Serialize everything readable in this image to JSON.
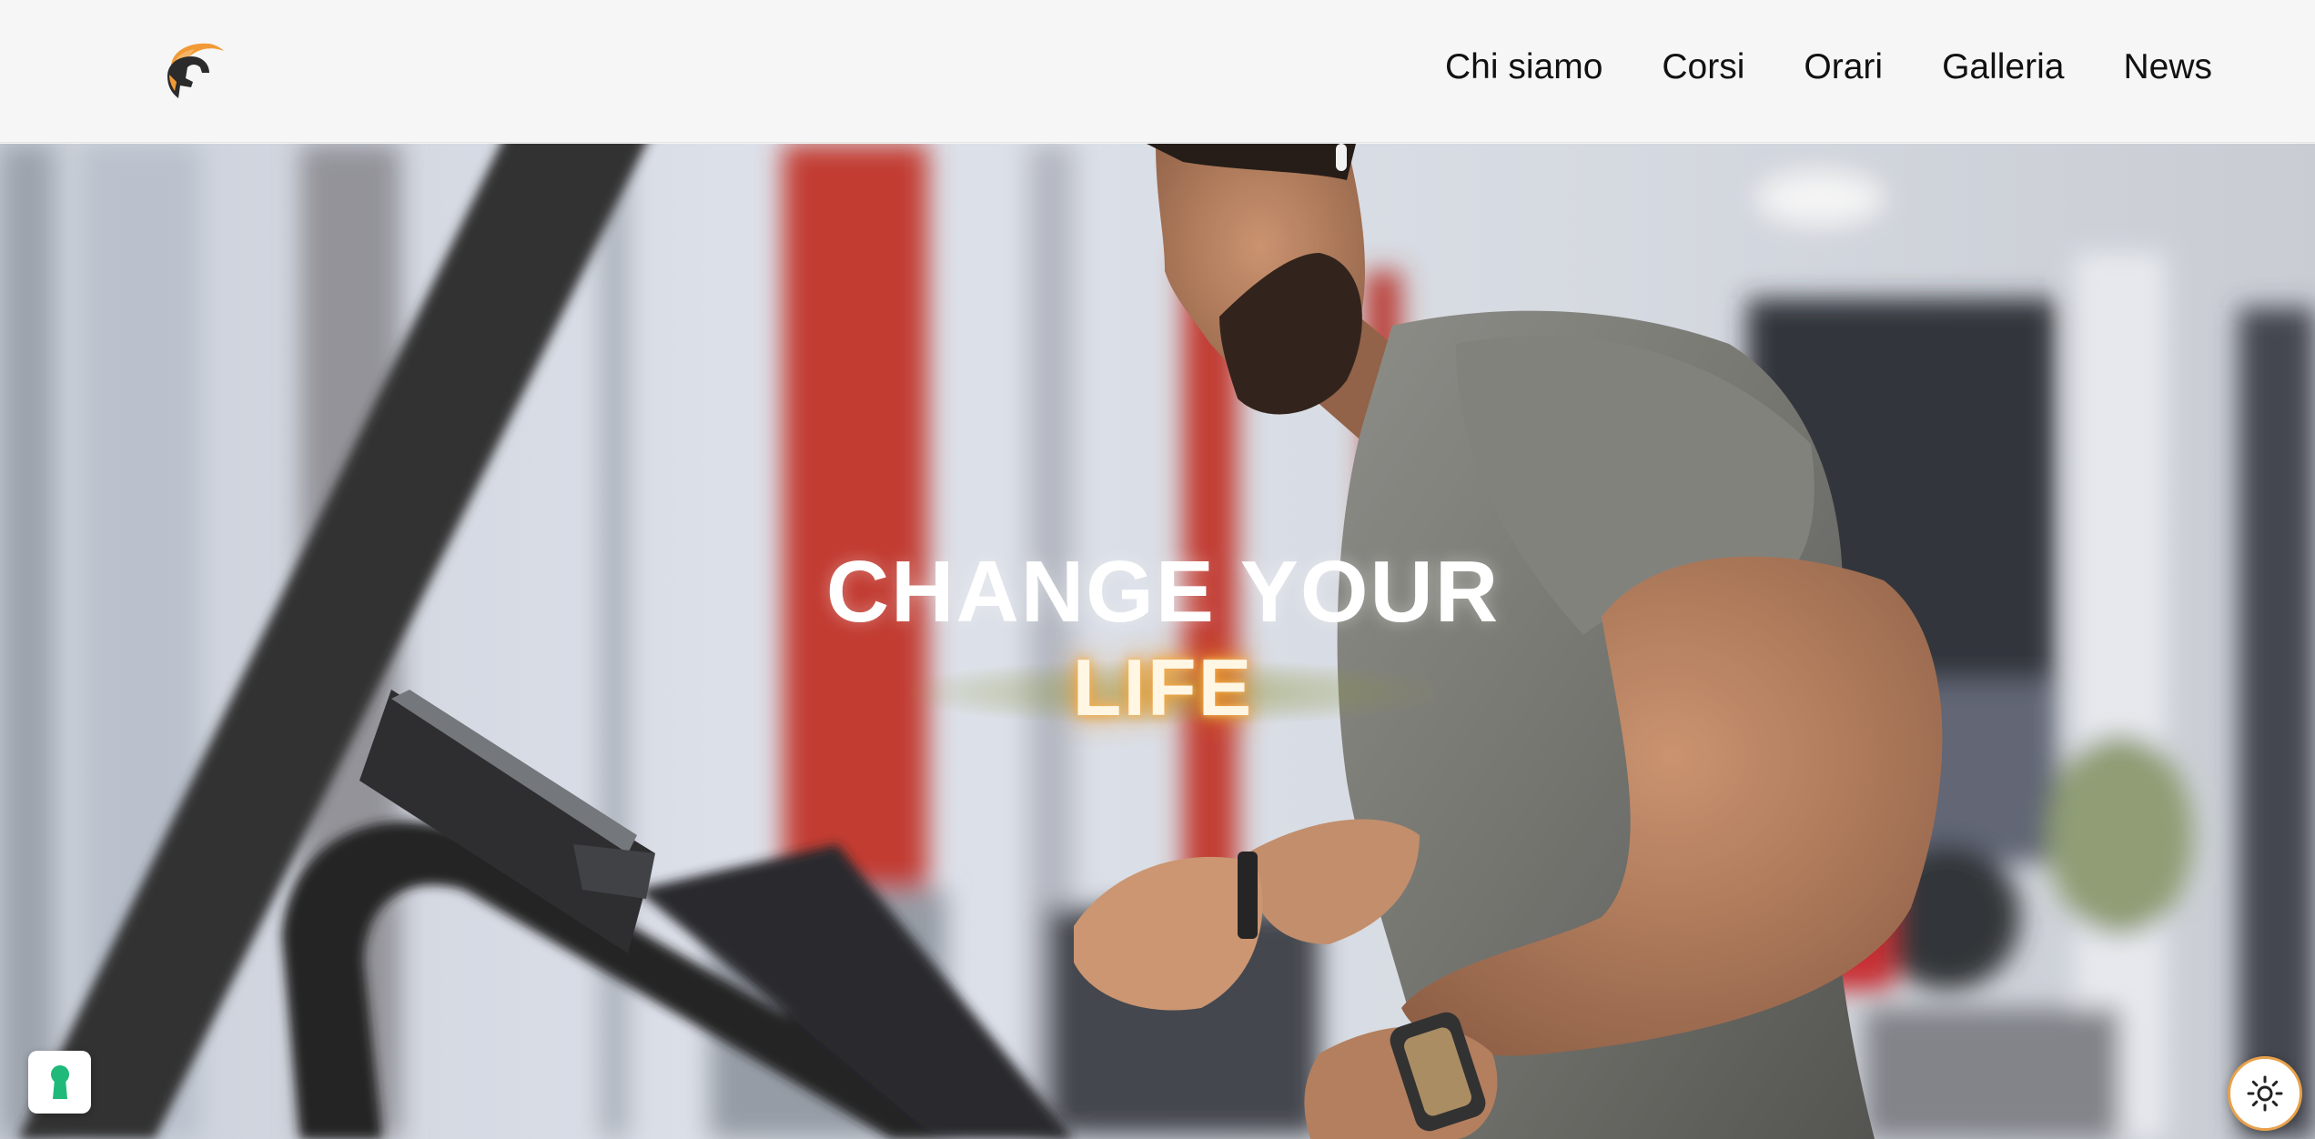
{
  "header": {
    "logo_icon": "spartan-helmet-logo",
    "nav": [
      {
        "label": "Chi siamo"
      },
      {
        "label": "Corsi"
      },
      {
        "label": "Orari"
      },
      {
        "label": "Galleria"
      },
      {
        "label": "News"
      }
    ]
  },
  "hero": {
    "title_line1": "CHANGE YOUR",
    "title_line2": "LIFE",
    "image": "man-running-on-treadmill-photo"
  },
  "widgets": {
    "privacy_icon": "keyhole-icon",
    "theme_icon": "sun-icon"
  },
  "colors": {
    "accent": "#f19a36",
    "header_bg": "#f6f6f6",
    "nav_text": "#111111",
    "privacy_green": "#1fb97a"
  }
}
